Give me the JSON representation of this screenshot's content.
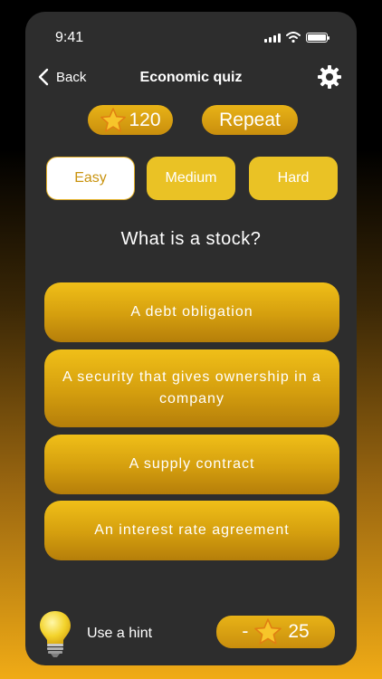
{
  "status_bar": {
    "time": "9:41"
  },
  "header": {
    "back_label": "Back",
    "title": "Economic quiz"
  },
  "coins": {
    "value": "120"
  },
  "repeat_label": "Repeat",
  "levels": [
    {
      "label": "Easy",
      "selected": true
    },
    {
      "label": "Medium",
      "selected": false
    },
    {
      "label": "Hard",
      "selected": false
    }
  ],
  "question": "What is a stock?",
  "answers": [
    "A debt obligation",
    "A security that gives ownership in a company",
    "A supply contract",
    "An interest rate agreement"
  ],
  "hint": {
    "label": "Use a hint",
    "cost_prefix": "-",
    "cost_value": "25"
  },
  "colors": {
    "accent": "#e8b317",
    "panel": "#2d2d2d",
    "selected_text": "#c9930f"
  },
  "icons": [
    "back-chevron-icon",
    "gear-icon",
    "star-icon",
    "lightbulb-icon",
    "signal-icon",
    "wifi-icon",
    "battery-icon"
  ]
}
